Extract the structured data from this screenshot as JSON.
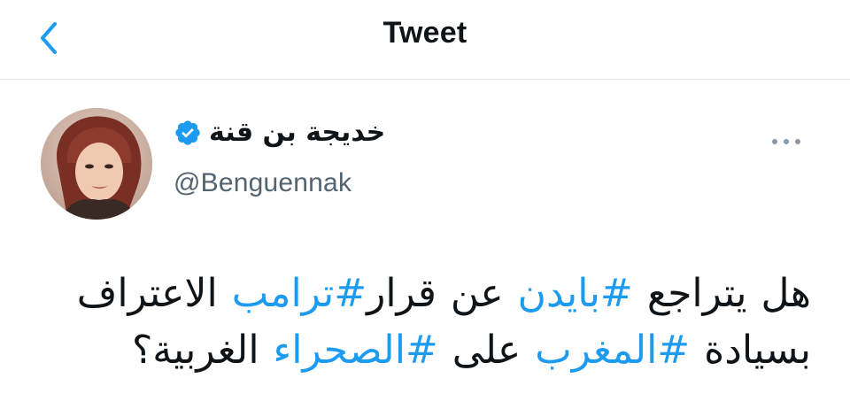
{
  "header": {
    "title": "Tweet",
    "back_icon": "chevron-left-icon",
    "accent_color": "#1d9bf0"
  },
  "author": {
    "name": "خديجة بن قنة",
    "handle": "@Benguennak",
    "verified": true,
    "verified_icon": "verified-badge-icon",
    "avatar_icon": "profile-photo"
  },
  "more_icon": "more-dots-icon",
  "tweet": {
    "line1": {
      "w1": "هل",
      "w2": "يتراجع",
      "tag1": "#بايدن",
      "w3": "عن",
      "w4": "قرار",
      "tag2": "#ترامب",
      "w5": "الاعتراف"
    },
    "line2": {
      "w1": "بسيادة",
      "tag1": "#المغرب",
      "w2": "على",
      "tag2": "#الصحراء",
      "w3": "الغربية؟"
    }
  }
}
